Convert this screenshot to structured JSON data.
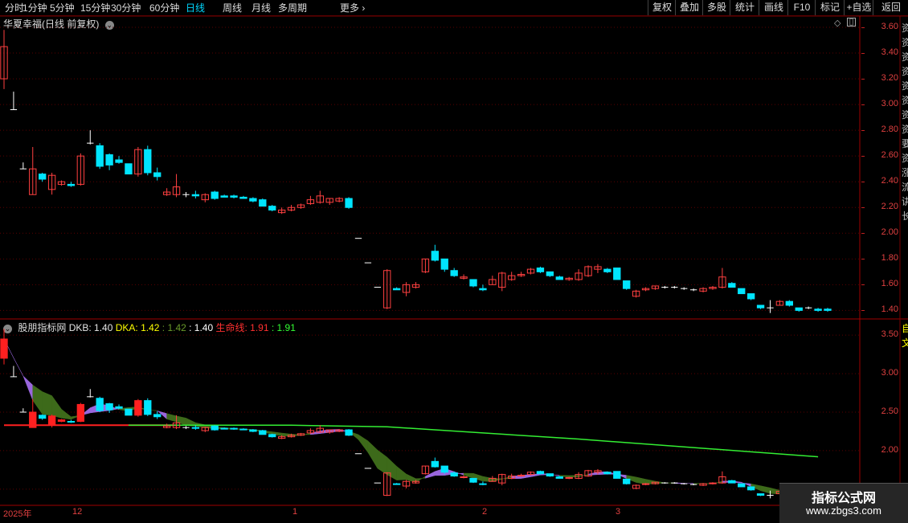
{
  "toolbar": {
    "periods": [
      "分时",
      "1分钟",
      "5分钟",
      "15分钟",
      "30分钟",
      "60分钟",
      "日线",
      "周线",
      "月线",
      "多周期",
      "更多"
    ],
    "active_period": "日线",
    "right_buttons": [
      "复权",
      "叠加",
      "多股",
      "统计",
      "画线",
      "F10",
      "标记",
      "+自选",
      "返回"
    ]
  },
  "main_panel": {
    "title": "华夏幸福(日线 前复权)",
    "price_ticks": [
      "3.60",
      "3.40",
      "3.20",
      "3.00",
      "2.80",
      "2.60",
      "2.40",
      "2.20",
      "2.00",
      "1.80",
      "1.60",
      "1.40"
    ]
  },
  "indicator_panel": {
    "name": "股朋指标网",
    "legend": [
      {
        "label": "DKB: 1.40",
        "color": "#e6e6e6"
      },
      {
        "label": "DKA: 1.42",
        "color": "#ffff00"
      },
      {
        "label": ": 1.42",
        "color": "#6a9a2a"
      },
      {
        "label": ": 1.40",
        "color": "#ffffff"
      },
      {
        "label": "生命线: 1.91",
        "color": "#ff3030"
      },
      {
        "label": ": 1.91",
        "color": "#33ff33"
      }
    ],
    "ticks": [
      "3.50",
      "3.00",
      "2.50",
      "2.00",
      "1.50"
    ]
  },
  "time_axis": {
    "labels": [
      "2025年",
      "12",
      "1",
      "2",
      "3"
    ]
  },
  "right_strip_text": "资资资资资资资资要资涨流讲长",
  "right_strip_text2": "自文",
  "watermark": {
    "title": "指标公式网",
    "url": "www.zbgs3.com"
  },
  "colors": {
    "up": "#ff4040",
    "down": "#00e5ff",
    "life_line": "#33ee33",
    "axis": "#e04040"
  },
  "chart_data": {
    "type": "candlestick",
    "series_ohlc": [
      [
        3.2,
        3.58,
        3.12,
        3.45
      ],
      [
        2.96,
        3.1,
        2.96,
        2.96
      ],
      [
        2.5,
        2.55,
        2.5,
        2.5
      ],
      [
        2.3,
        2.67,
        2.3,
        2.5
      ],
      [
        2.46,
        2.47,
        2.4,
        2.42
      ],
      [
        2.34,
        2.47,
        2.3,
        2.45
      ],
      [
        2.38,
        2.41,
        2.37,
        2.4
      ],
      [
        2.38,
        2.4,
        2.36,
        2.37
      ],
      [
        2.38,
        2.62,
        2.37,
        2.6
      ],
      [
        2.7,
        2.8,
        2.69,
        2.7
      ],
      [
        2.68,
        2.7,
        2.5,
        2.52
      ],
      [
        2.61,
        2.62,
        2.49,
        2.53
      ],
      [
        2.57,
        2.6,
        2.54,
        2.55
      ],
      [
        2.54,
        2.54,
        2.46,
        2.46
      ],
      [
        2.46,
        2.67,
        2.44,
        2.65
      ],
      [
        2.65,
        2.68,
        2.45,
        2.47
      ],
      [
        2.47,
        2.51,
        2.41,
        2.44
      ],
      [
        2.3,
        2.35,
        2.29,
        2.32
      ],
      [
        2.3,
        2.46,
        2.28,
        2.36
      ],
      [
        2.3,
        2.32,
        2.28,
        2.3
      ],
      [
        2.3,
        2.33,
        2.27,
        2.29
      ],
      [
        2.26,
        2.31,
        2.24,
        2.3
      ],
      [
        2.32,
        2.33,
        2.26,
        2.27
      ],
      [
        2.29,
        2.3,
        2.28,
        2.28
      ],
      [
        2.29,
        2.3,
        2.27,
        2.28
      ],
      [
        2.28,
        2.29,
        2.27,
        2.27
      ],
      [
        2.27,
        2.28,
        2.24,
        2.25
      ],
      [
        2.26,
        2.27,
        2.23,
        2.21
      ],
      [
        2.21,
        2.22,
        2.17,
        2.18
      ],
      [
        2.16,
        2.2,
        2.15,
        2.18
      ],
      [
        2.18,
        2.22,
        2.17,
        2.2
      ],
      [
        2.2,
        2.23,
        2.19,
        2.22
      ],
      [
        2.23,
        2.29,
        2.22,
        2.26
      ],
      [
        2.24,
        2.33,
        2.23,
        2.29
      ],
      [
        2.24,
        2.27,
        2.22,
        2.27
      ],
      [
        2.25,
        2.28,
        2.24,
        2.27
      ],
      [
        2.27,
        2.28,
        2.19,
        2.2
      ],
      [
        1.96,
        1.96,
        1.96,
        1.96
      ],
      [
        1.77,
        1.77,
        1.77,
        1.77
      ],
      [
        1.58,
        1.58,
        1.58,
        1.58
      ],
      [
        1.42,
        1.72,
        1.41,
        1.71
      ],
      [
        1.57,
        1.58,
        1.56,
        1.56
      ],
      [
        1.54,
        1.62,
        1.51,
        1.6
      ],
      [
        1.58,
        1.62,
        1.57,
        1.6
      ],
      [
        1.7,
        1.8,
        1.69,
        1.8
      ],
      [
        1.86,
        1.91,
        1.78,
        1.79
      ],
      [
        1.8,
        1.8,
        1.7,
        1.72
      ],
      [
        1.71,
        1.73,
        1.66,
        1.67
      ],
      [
        1.65,
        1.68,
        1.64,
        1.66
      ],
      [
        1.64,
        1.64,
        1.58,
        1.59
      ],
      [
        1.57,
        1.6,
        1.55,
        1.56
      ],
      [
        1.6,
        1.67,
        1.6,
        1.64
      ],
      [
        1.58,
        1.7,
        1.55,
        1.69
      ],
      [
        1.64,
        1.7,
        1.63,
        1.67
      ],
      [
        1.67,
        1.7,
        1.66,
        1.68
      ],
      [
        1.69,
        1.73,
        1.68,
        1.72
      ],
      [
        1.73,
        1.74,
        1.69,
        1.7
      ],
      [
        1.7,
        1.7,
        1.66,
        1.67
      ],
      [
        1.66,
        1.67,
        1.64,
        1.64
      ],
      [
        1.64,
        1.66,
        1.63,
        1.65
      ],
      [
        1.64,
        1.72,
        1.63,
        1.69
      ],
      [
        1.67,
        1.75,
        1.66,
        1.74
      ],
      [
        1.72,
        1.76,
        1.69,
        1.74
      ],
      [
        1.72,
        1.73,
        1.69,
        1.7
      ],
      [
        1.73,
        1.73,
        1.64,
        1.64
      ],
      [
        1.63,
        1.63,
        1.56,
        1.57
      ],
      [
        1.51,
        1.56,
        1.5,
        1.55
      ],
      [
        1.56,
        1.58,
        1.55,
        1.57
      ],
      [
        1.57,
        1.59,
        1.56,
        1.59
      ],
      [
        1.58,
        1.59,
        1.57,
        1.58
      ],
      [
        1.58,
        1.59,
        1.57,
        1.58
      ],
      [
        1.57,
        1.58,
        1.56,
        1.57
      ],
      [
        1.56,
        1.57,
        1.55,
        1.56
      ],
      [
        1.55,
        1.58,
        1.54,
        1.57
      ],
      [
        1.57,
        1.59,
        1.56,
        1.58
      ],
      [
        1.58,
        1.73,
        1.57,
        1.66
      ],
      [
        1.61,
        1.62,
        1.58,
        1.58
      ],
      [
        1.57,
        1.57,
        1.53,
        1.53
      ],
      [
        1.53,
        1.53,
        1.48,
        1.49
      ],
      [
        1.44,
        1.44,
        1.41,
        1.42
      ],
      [
        1.42,
        1.48,
        1.38,
        1.42
      ],
      [
        1.44,
        1.48,
        1.44,
        1.47
      ],
      [
        1.47,
        1.48,
        1.43,
        1.44
      ],
      [
        1.42,
        1.42,
        1.39,
        1.4
      ],
      [
        1.42,
        1.43,
        1.41,
        1.42
      ],
      [
        1.41,
        1.42,
        1.39,
        1.4
      ],
      [
        1.41,
        1.42,
        1.39,
        1.4
      ]
    ],
    "price_range": [
      1.34,
      3.65
    ],
    "life_line": [
      [
        13,
        2.33
      ],
      [
        30,
        2.33
      ],
      [
        40,
        2.31
      ],
      [
        60,
        2.15
      ],
      [
        85,
        1.92
      ]
    ],
    "indicator_range": [
      1.3,
      3.7
    ]
  }
}
